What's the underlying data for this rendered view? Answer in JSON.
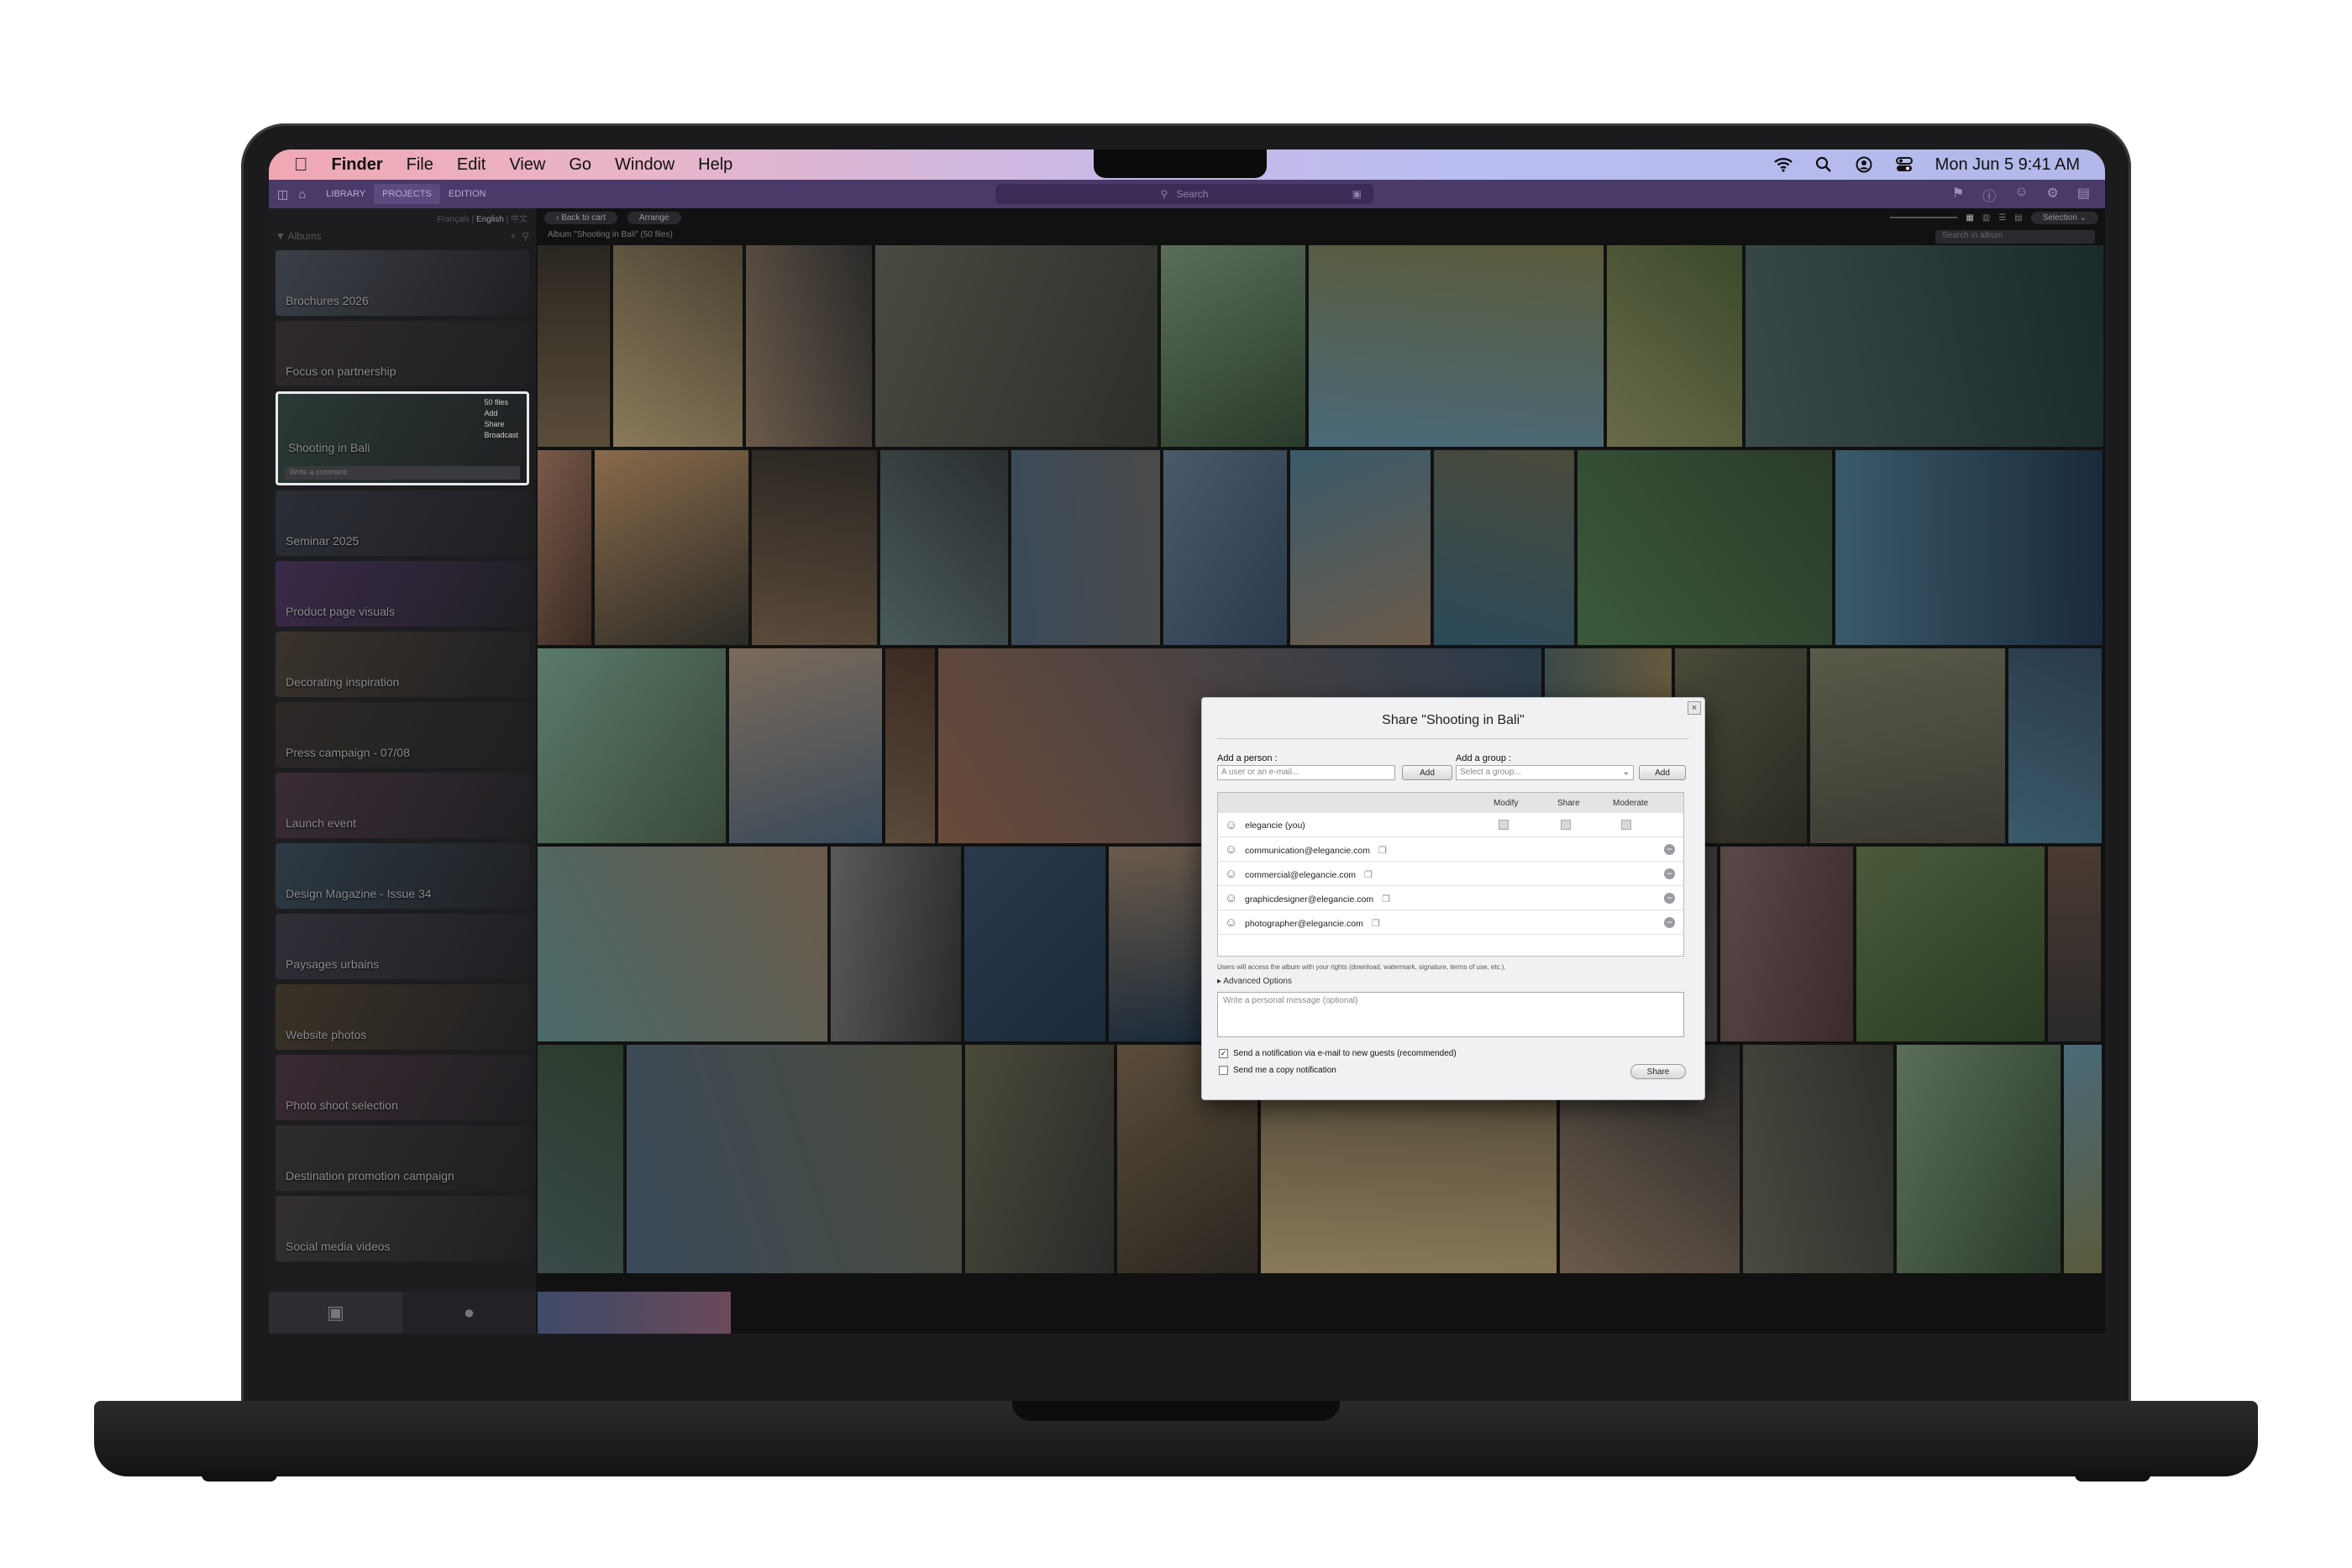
{
  "menubar": {
    "app": "Finder",
    "items": [
      "File",
      "Edit",
      "View",
      "Go",
      "Window",
      "Help"
    ],
    "clock": "Mon Jun 5  9:41 AM"
  },
  "apptoolbar": {
    "tabs": [
      "LIBRARY",
      "PROJECTS",
      "EDITION"
    ],
    "search_placeholder": "Search"
  },
  "sidebar": {
    "languages": [
      "Français",
      "English",
      "中文"
    ],
    "albums_label": "Albums",
    "albums": [
      {
        "label": "Brochures 2026",
        "color": "#3b3f47"
      },
      {
        "label": "Focus on partnership",
        "color": "#2f2a2a"
      },
      {
        "label": "Shooting in Bali",
        "color": "#2a3a34",
        "selected": true,
        "files": "50 files",
        "actions": [
          "Add",
          "Share",
          "Broadcast"
        ],
        "comment_placeholder": "Write a comment"
      },
      {
        "label": "Seminar 2025",
        "color": "#2b2e36"
      },
      {
        "label": "Product page visuals",
        "color": "#3a2a4a"
      },
      {
        "label": "Decorating inspiration",
        "color": "#3a332c"
      },
      {
        "label": "Press campaign - 07/08",
        "color": "#2c2826"
      },
      {
        "label": "Launch event",
        "color": "#3a2c35"
      },
      {
        "label": "Design Magazine - Issue 34",
        "color": "#2c3a44"
      },
      {
        "label": "Paysages urbains",
        "color": "#2f3038"
      },
      {
        "label": "Website photos",
        "color": "#3a3226"
      },
      {
        "label": "Photo shoot selection",
        "color": "#3a2a33"
      },
      {
        "label": "Destination promotion campaign",
        "color": "#2e2c2a"
      },
      {
        "label": "Social media videos",
        "color": "#33302f"
      }
    ]
  },
  "content": {
    "back_to_cart": "Back to cart",
    "arrange": "Arrange",
    "selection": "Selection",
    "album_title": "Album \"Shooting in Bali\" (50 files)",
    "search_album_placeholder": "Search in album"
  },
  "dialog": {
    "title": "Share \"Shooting in Bali\"",
    "add_person_label": "Add a person :",
    "person_placeholder": "A user or an e-mail...",
    "add_person_button": "Add",
    "add_group_label": "Add a group :",
    "group_placeholder": "Select a group...",
    "add_group_button": "Add",
    "columns": [
      "Modify",
      "Share",
      "Moderate"
    ],
    "users": [
      {
        "name": "elegancie (you)",
        "owner": true
      },
      {
        "name": "communication@elegancie.com"
      },
      {
        "name": "commercial@elegancie.com"
      },
      {
        "name": "graphicdesigner@elegancie.com"
      },
      {
        "name": "photographer@elegancie.com"
      }
    ],
    "rights_note": "Users will access the album with your rights (download, watermark, signature, terms of use, etc.).",
    "advanced_options": "Advanced Options",
    "message_placeholder": "Write a personal message (optional)",
    "notify_label": "Send a notification via e-mail to new guests (recommended)",
    "copy_label": "Send me a copy notification",
    "share_button": "Share"
  },
  "photos": [
    {
      "c1": "#5a4c3a",
      "c2": "#2a2620"
    },
    {
      "c1": "#8a7a5a",
      "c2": "#4a4232"
    },
    {
      "c1": "#6a5a4a",
      "c2": "#2a2a2a"
    },
    {
      "c1": "#4a4a42",
      "c2": "#2c2e28"
    },
    {
      "c1": "#5a6e5a",
      "c2": "#2a3a2a"
    },
    {
      "c1": "#4a6a7a",
      "c2": "#5a5a3a"
    },
    {
      "c1": "#6a6a4a",
      "c2": "#3a4a2a"
    },
    {
      "c1": "#3a4a4a",
      "c2": "#1a2a2a"
    },
    {
      "c1": "#7a5a4a",
      "c2": "#3a2a22"
    },
    {
      "c1": "#8a6a4a",
      "c2": "#2a2a26"
    },
    {
      "c1": "#5a4a3a",
      "c2": "#2a2622"
    },
    {
      "c1": "#4a5a5a",
      "c2": "#2a2e30"
    },
    {
      "c1": "#3a4a5a",
      "c2": "#4a4a4a"
    },
    {
      "c1": "#4a5a6a",
      "c2": "#2a3a4a"
    },
    {
      "c1": "#3a5a6a",
      "c2": "#6a5a4a"
    },
    {
      "c1": "#2a4a5a",
      "c2": "#4a4a3a"
    },
    {
      "c1": "#3a5a3a",
      "c2": "#2a3a2a"
    },
    {
      "c1": "#3a5a6a",
      "c2": "#1a2a3a"
    },
    {
      "c1": "#5a7a6a",
      "c2": "#3a4a3a"
    },
    {
      "c1": "#7a6a5a",
      "c2": "#3a4a5a"
    },
    {
      "c1": "#5a4a3a",
      "c2": "#3a2a22"
    },
    {
      "c1": "#6a4a3a",
      "c2": "#2a3a4a"
    },
    {
      "c1": "#3a4a4a",
      "c2": "#6a5a3a"
    },
    {
      "c1": "#4a4a3a",
      "c2": "#2a2a22"
    },
    {
      "c1": "#5a5a4a",
      "c2": "#3a3a32"
    },
    {
      "c1": "#3a5a6a",
      "c2": "#2a3a4a"
    },
    {
      "c1": "#4a6a6a",
      "c2": "#6a5a4a"
    },
    {
      "c1": "#5a5a5a",
      "c2": "#2a2a2a"
    },
    {
      "c1": "#2a3a4a",
      "c2": "#1a2a3a"
    },
    {
      "c1": "#6a5a4a",
      "c2": "#1a2a3a"
    },
    {
      "c1": "#3a3a32",
      "c2": "#4a4a3a"
    },
    {
      "c1": "#5a5a5a",
      "c2": "#3a3a3a"
    },
    {
      "c1": "#5a4a4a",
      "c2": "#3a2a2a"
    },
    {
      "c1": "#4a5a3a",
      "c2": "#2a3a22"
    },
    {
      "c1": "#4a3a32",
      "c2": "#2a2a2a"
    },
    {
      "c1": "#3a4a4a",
      "c2": "#2a3a2a"
    },
    {
      "c1": "#3a4a5a",
      "c2": "#4a4a3a"
    },
    {
      "c1": "#4a4a3a",
      "c2": "#2a2a2a"
    }
  ]
}
